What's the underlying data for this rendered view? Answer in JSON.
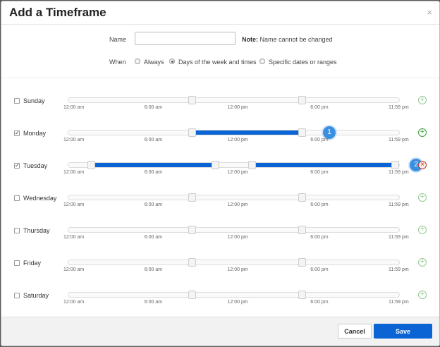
{
  "dialog": {
    "title": "Add a Timeframe",
    "close": "×",
    "name_label": "Name",
    "name_value": "",
    "name_placeholder": "",
    "note_strong": "Note:",
    "note_text": " Name cannot be changed",
    "when_label": "When",
    "when_options": [
      {
        "label": "Always",
        "selected": false
      },
      {
        "label": "Days of the week and times",
        "selected": true
      },
      {
        "label": "Specific dates or ranges",
        "selected": false
      }
    ],
    "tick_labels": [
      "12:00 am",
      "6:00 am",
      "12:00 pm",
      "6:00 pm",
      "11:59 pm"
    ],
    "add_symbol": "+",
    "delete_symbol": "×",
    "check_mark": "✓"
  },
  "days": [
    {
      "label": "Sunday",
      "checked": false,
      "ranges": [],
      "action": "add-faint"
    },
    {
      "label": "Monday",
      "checked": true,
      "ranges": [
        {
          "start": 0.375,
          "end": 0.708,
          "badge": "1"
        }
      ],
      "action": "add"
    },
    {
      "label": "Tuesday",
      "checked": true,
      "ranges": [
        {
          "start": 0.07,
          "end": 0.446
        },
        {
          "start": 0.557,
          "end": 0.99,
          "badge": "2"
        }
      ],
      "action": "delete"
    },
    {
      "label": "Wednesday",
      "checked": false,
      "ranges": [],
      "action": "add-faint"
    },
    {
      "label": "Thursday",
      "checked": false,
      "ranges": [],
      "action": "add-faint"
    },
    {
      "label": "Friday",
      "checked": false,
      "ranges": [],
      "action": "add-faint"
    },
    {
      "label": "Saturday",
      "checked": false,
      "ranges": [],
      "action": "add-faint"
    }
  ],
  "footer": {
    "cancel_label": "Cancel",
    "save_label": "Save"
  }
}
